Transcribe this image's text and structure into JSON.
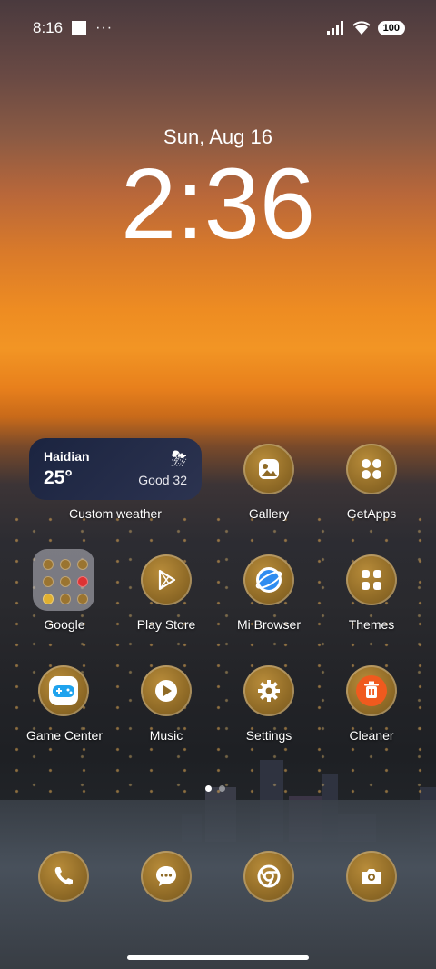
{
  "status_bar": {
    "time": "8:16",
    "overflow": "···",
    "battery": "100",
    "icons": [
      "signal-icon",
      "wifi-icon"
    ]
  },
  "lock": {
    "date": "Sun, Aug 16",
    "time": "2:36"
  },
  "weather": {
    "city": "Haidian",
    "temp": "25°",
    "aqi": "Good 32",
    "label": "Custom weather",
    "icon": "thunderstorm-icon"
  },
  "apps": {
    "gallery": "Gallery",
    "getapps": "GetApps",
    "google": "Google",
    "playstore": "Play Store",
    "mibrowser": "Mi Browser",
    "themes": "Themes",
    "gamecenter": "Game Center",
    "music": "Music",
    "settings": "Settings",
    "cleaner": "Cleaner"
  },
  "dock": [
    "phone-icon",
    "messages-icon",
    "chrome-icon",
    "camera-icon"
  ],
  "pager": {
    "pages": 2,
    "current": 1
  }
}
